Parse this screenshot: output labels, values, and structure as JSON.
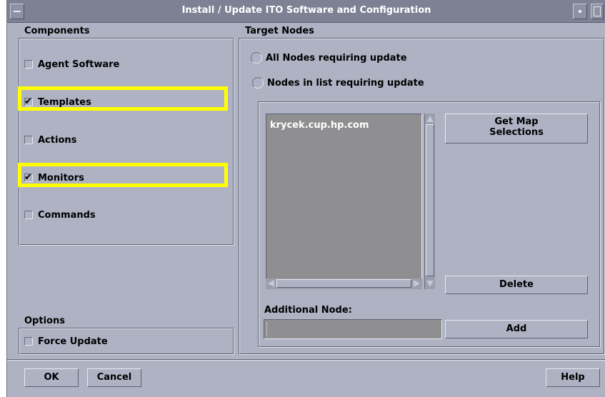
{
  "window": {
    "title": "Install / Update ITO Software and Configuration"
  },
  "components": {
    "label": "Components",
    "items": [
      {
        "label": "Agent Software",
        "checked": false
      },
      {
        "label": "Templates",
        "checked": true
      },
      {
        "label": "Actions",
        "checked": false
      },
      {
        "label": "Monitors",
        "checked": true
      },
      {
        "label": "Commands",
        "checked": false
      }
    ]
  },
  "options": {
    "label": "Options",
    "force_update": {
      "label": "Force Update",
      "checked": false
    }
  },
  "target_nodes": {
    "label": "Target Nodes",
    "radio_all": "All Nodes requiring update",
    "radio_list": "Nodes in list requiring update",
    "nodes": [
      "krycek.cup.hp.com"
    ],
    "get_map_label_line1": "Get Map",
    "get_map_label_line2": "Selections",
    "delete_label": "Delete",
    "additional_node_label": "Additional Node:",
    "additional_node_value": "",
    "add_label": "Add"
  },
  "footer": {
    "ok_label": "OK",
    "cancel_label": "Cancel",
    "help_label": "Help"
  },
  "colors": {
    "dialog_bg": "#aeb2c3",
    "titlebar_bg": "#7d8193",
    "highlight": "#ffff00",
    "list_bg": "#8f8f92"
  },
  "icons": {
    "window_menu": "window-menu-icon",
    "minimize": "minimize-icon",
    "maximize": "maximize-icon"
  }
}
